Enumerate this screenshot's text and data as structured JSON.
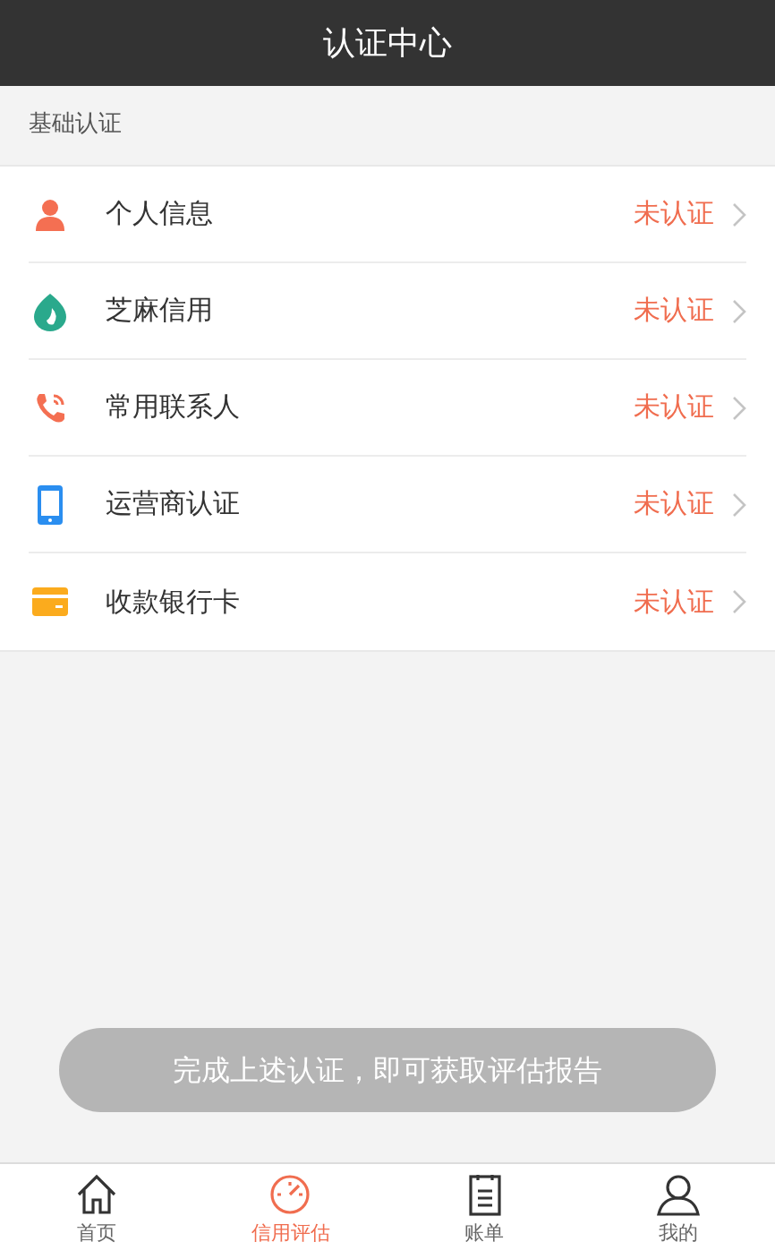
{
  "header": {
    "title": "认证中心"
  },
  "section": {
    "title": "基础认证"
  },
  "items": [
    {
      "kind": "person",
      "label": "个人信息",
      "status": "未认证"
    },
    {
      "kind": "sesame",
      "label": "芝麻信用",
      "status": "未认证"
    },
    {
      "kind": "phone",
      "label": "常用联系人",
      "status": "未认证"
    },
    {
      "kind": "mobile",
      "label": "运营商认证",
      "status": "未认证"
    },
    {
      "kind": "card",
      "label": "收款银行卡",
      "status": "未认证"
    }
  ],
  "submit_button": {
    "label": "完成上述认证，即可获取评估报告",
    "disabled": true
  },
  "tab_bar": [
    {
      "kind": "home",
      "label": "首页",
      "selected": false
    },
    {
      "kind": "gauge",
      "label": "信用评估",
      "selected": true
    },
    {
      "kind": "bill",
      "label": "账单",
      "selected": false
    },
    {
      "kind": "user",
      "label": "我的",
      "selected": false
    }
  ]
}
